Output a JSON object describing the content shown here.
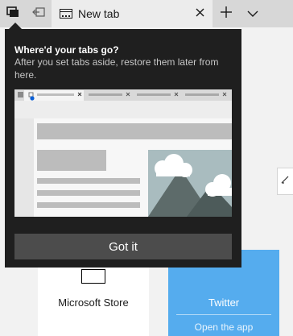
{
  "tabs_bar": {
    "set_aside_icon": "tabs-set-aside-icon",
    "set_aside_action_icon": "set-aside-arrow-icon",
    "active_tab": {
      "title": "New tab",
      "favicon": "new-tab-page-icon",
      "close_icon": "close-icon"
    },
    "new_tab_icon": "plus-icon",
    "tab_list_icon": "chevron-down-icon"
  },
  "callout": {
    "title": "Where'd your tabs go?",
    "description": "After you set tabs aside, restore them later from here.",
    "illustration": "tabs-aside-illustration",
    "button_label": "Got it"
  },
  "tiles": [
    {
      "name": "Microsoft Store",
      "icon": "store-icon"
    },
    {
      "name": "Twitter",
      "icon": "twitter-icon",
      "action": "Open the app"
    }
  ],
  "colors": {
    "tabbar_bg": "#d7d7d7",
    "active_tab_bg": "#ececec",
    "callout_bg": "#1f1f1f",
    "button_bg": "#4c4c4c",
    "twitter_tile": "#55acee",
    "accent_blue": "#0b5fd6"
  }
}
